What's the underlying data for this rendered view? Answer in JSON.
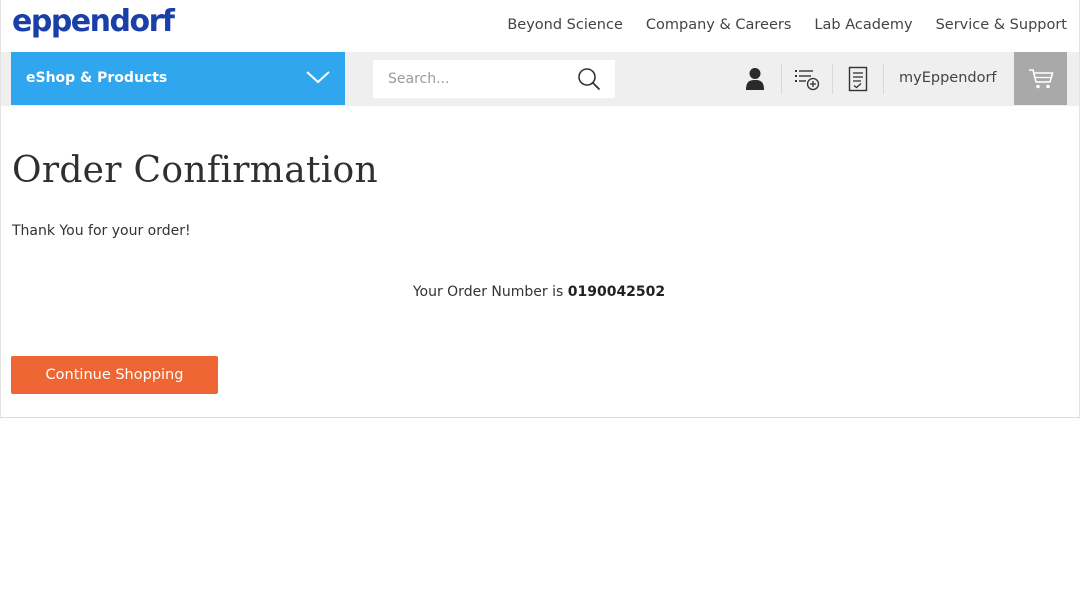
{
  "header": {
    "logo_text": "eppendorf",
    "brand_color": "#1a3fa8",
    "nav": [
      "Beyond Science",
      "Company & Careers",
      "Lab Academy",
      "Service & Support"
    ]
  },
  "navbar": {
    "eshop_label": "eShop & Products",
    "eshop_color": "#2fa6ee",
    "search_placeholder": "Search...",
    "account_label": "myEppendorf",
    "icons": [
      "user-icon",
      "list-add-icon",
      "document-icon",
      "cart-icon"
    ]
  },
  "content": {
    "title": "Order Confirmation",
    "thanks": "Thank You for your order!",
    "order_prefix": "Your Order Number is",
    "order_number": "0190042502",
    "cta_label": "Continue Shopping",
    "cta_color": "#ee6633"
  }
}
